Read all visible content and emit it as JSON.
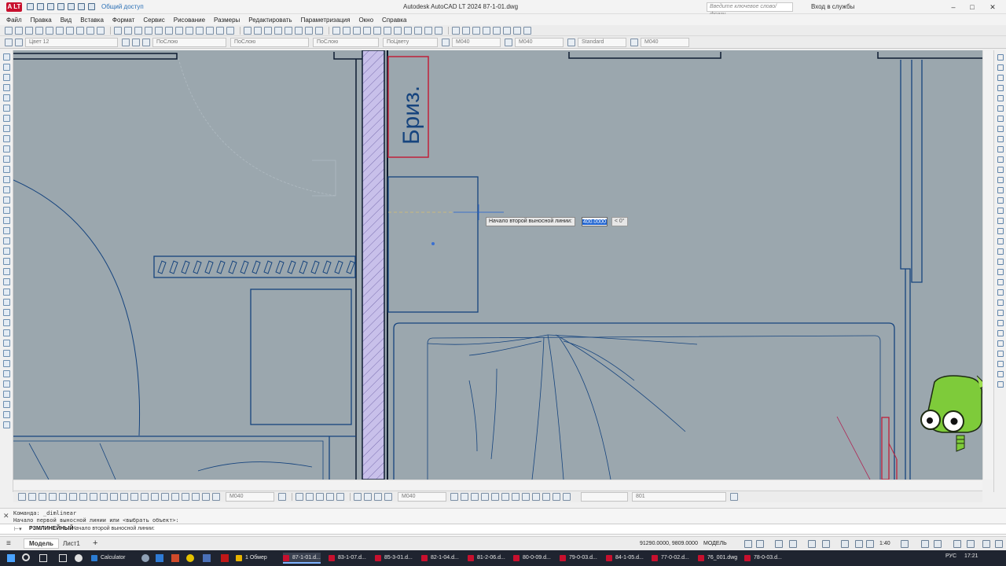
{
  "window": {
    "title": "Autodesk AutoCAD LT 2024    87-1-01.dwg",
    "app_badge": "A LT",
    "share_label": "Общий доступ",
    "search_placeholder": "Введите ключевое слово/фразу",
    "sign_in": "Вход в службы",
    "minimize": "–",
    "maximize": "□",
    "close": "✕"
  },
  "menu": [
    "Файл",
    "Правка",
    "Вид",
    "Вставка",
    "Формат",
    "Сервис",
    "Рисование",
    "Размеры",
    "Редактировать",
    "Параметризация",
    "Окно",
    "Справка"
  ],
  "properties_bar": {
    "layer_combo": "Цвет 12",
    "color_combo": "ПоСлою",
    "linetype_combo": "ПоСлою",
    "lineweight_combo": "ПоСлою",
    "plotstyle_combo": "ПоЦвету",
    "text_style_combo": "M040",
    "dim_style_combo": "M040",
    "table_style_combo": "Standard",
    "multileader_combo": "M040"
  },
  "drawing": {
    "room_label": "Бриз.",
    "accent_blue": "#16447e",
    "label_red": "#c0203a",
    "canvas_bg": "#9ba7ae",
    "wall_hatch": "#c8c0ea"
  },
  "dynamic_input": {
    "prompt": "Начало второй выносной линии:",
    "value": "400.0000",
    "angle": "< 0°"
  },
  "dimension_toolbar": {
    "dim_combo": "M040",
    "text_combo": "M040",
    "field": "801"
  },
  "command_line": {
    "history_1": "Команда: _dimlinear",
    "history_2": "Начало первой выносной линии или <выбрать объект>:",
    "current_command": "РЗМЛИНЕЙНЫЙ",
    "current_prompt": "Начало второй выносной линии:"
  },
  "status": {
    "tab_model": "Модель",
    "tab_sheet": "Лист1",
    "add_tab": "+",
    "coords": "91290.0000, 9809.0000",
    "space": "МОДЕЛЬ",
    "scale": "1:40"
  },
  "taskbar": {
    "items": [
      {
        "label": "Calculator",
        "color": "#2b7cd3"
      },
      {
        "label": "1 Обмер",
        "color": "#e8b400"
      },
      {
        "label": "87-1-01.d...",
        "color": "#c8102e"
      },
      {
        "label": "83-1-07.d...",
        "color": "#c8102e"
      },
      {
        "label": "85-3-01.d...",
        "color": "#c8102e"
      },
      {
        "label": "82-1-04.d...",
        "color": "#c8102e"
      },
      {
        "label": "81-2-06.d...",
        "color": "#c8102e"
      },
      {
        "label": "80-0-09.d...",
        "color": "#c8102e"
      },
      {
        "label": "79-0-03.d...",
        "color": "#c8102e"
      },
      {
        "label": "84-1-05.d...",
        "color": "#c8102e"
      },
      {
        "label": "77-0-02.d...",
        "color": "#c8102e"
      },
      {
        "label": "76_001.dwg",
        "color": "#c8102e"
      },
      {
        "label": "78-0-03.d...",
        "color": "#c8102e"
      }
    ],
    "language": "РУС",
    "time": "17:21"
  }
}
